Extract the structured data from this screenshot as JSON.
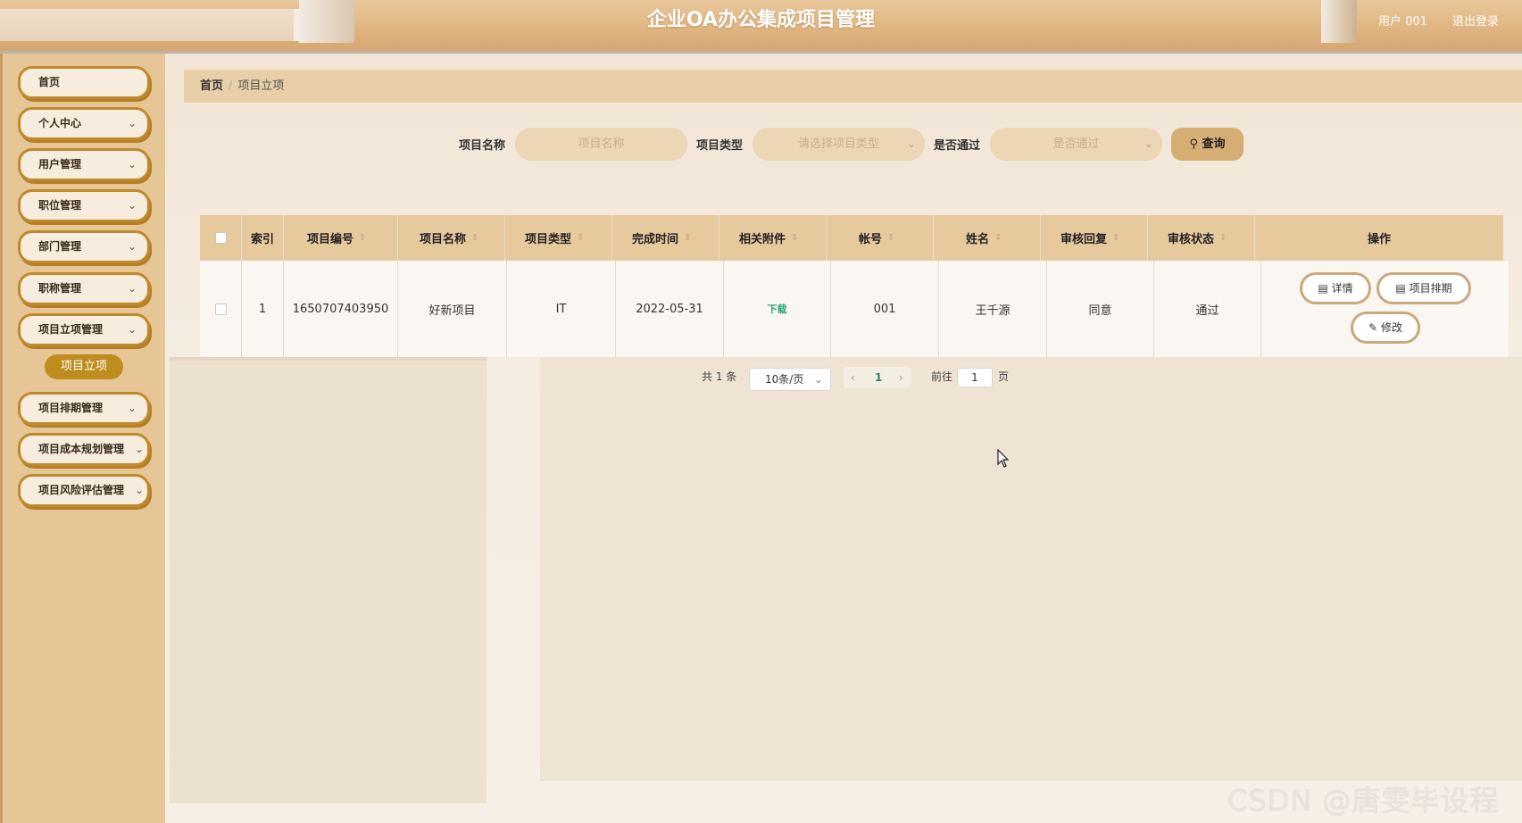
{
  "header": {
    "title": "企业OA办公集成项目管理",
    "user": "用户 001",
    "logout": "退出登录"
  },
  "sidebar": {
    "items": [
      {
        "label": "首页",
        "chevron": ""
      },
      {
        "label": "个人中心",
        "chevron": "⌄"
      },
      {
        "label": "用户管理",
        "chevron": "⌄"
      },
      {
        "label": "职位管理",
        "chevron": "⌄"
      },
      {
        "label": "部门管理",
        "chevron": "⌄"
      },
      {
        "label": "职称管理",
        "chevron": "⌄"
      },
      {
        "label": "项目立项管理",
        "chevron": "⌄"
      },
      {
        "label": "项目排期管理",
        "chevron": "⌄"
      },
      {
        "label": "项目成本规划管理",
        "chevron": "⌄"
      },
      {
        "label": "项目风险评估管理",
        "chevron": "⌄"
      }
    ],
    "active_sub": "项目立项"
  },
  "breadcrumb": {
    "home": "首页",
    "separator": "/",
    "current": "项目立项"
  },
  "search": {
    "name_label": "项目名称",
    "name_placeholder": "项目名称",
    "type_label": "项目类型",
    "type_placeholder": "请选择项目类型",
    "pass_label": "是否通过",
    "pass_placeholder": "是否通过",
    "query_label": "查询"
  },
  "table": {
    "columns": [
      "索引",
      "项目编号",
      "项目名称",
      "项目类型",
      "完成时间",
      "相关附件",
      "帐号",
      "姓名",
      "审核回复",
      "审核状态",
      "操作"
    ],
    "rows": [
      {
        "index": "1",
        "code": "1650707403950",
        "name": "好新项目",
        "type": "IT",
        "finish": "2022-05-31",
        "attachment": "下载",
        "account": "001",
        "person": "王千源",
        "reply": "同意",
        "status": "通过"
      }
    ],
    "actions": {
      "detail": "详情",
      "schedule": "项目排期",
      "edit": "修改"
    }
  },
  "pagination": {
    "total": "共 1 条",
    "page_size": "10条/页",
    "current_page": "1",
    "goto_label": "前往",
    "goto_value": "1",
    "page_suffix": "页"
  },
  "watermark": "CSDN @唐雯毕设程序",
  "colors": {
    "header": "#e2b986",
    "sidebar": "#e6c697",
    "menu_border": "#c08a2c",
    "active_sub": "#bf8d1e",
    "table_head": "#e7c99e",
    "download": "#2aa67a"
  }
}
